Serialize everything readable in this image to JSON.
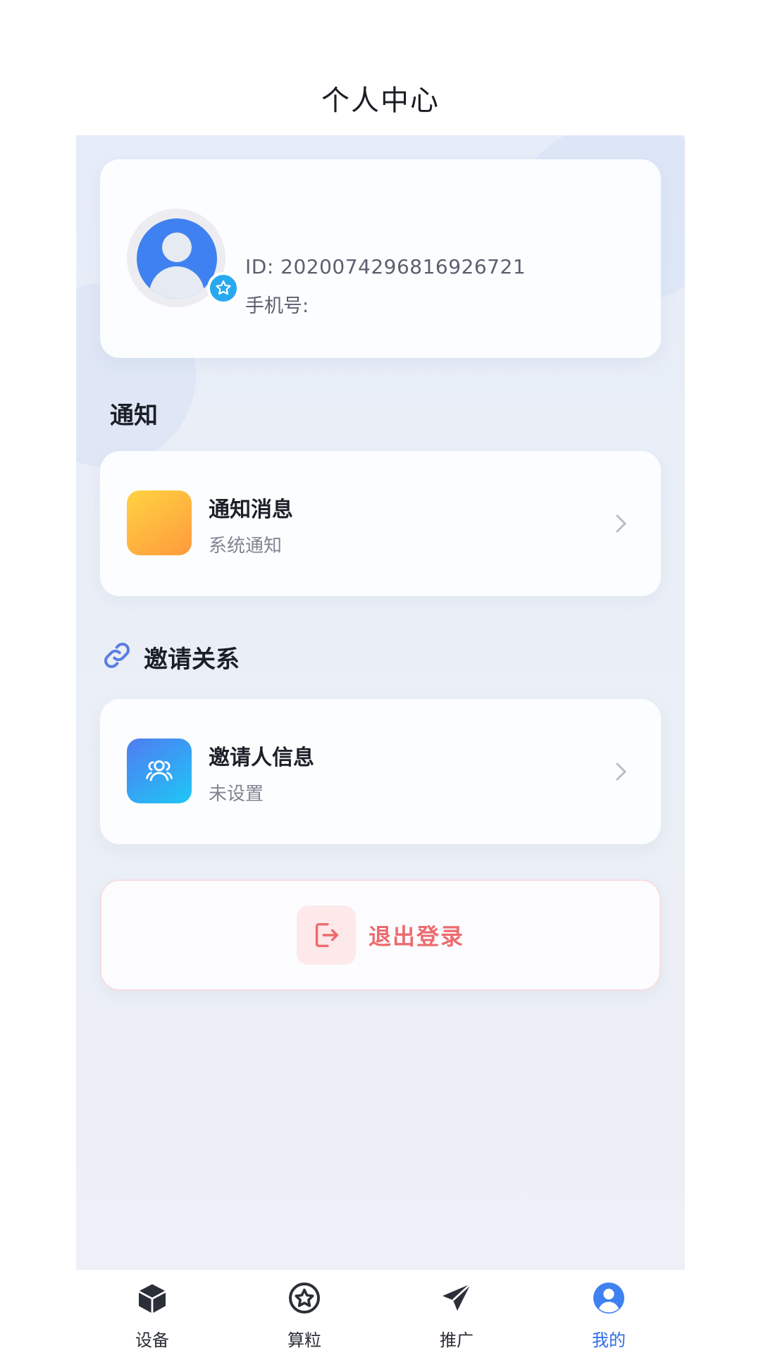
{
  "page": {
    "title": "个人中心"
  },
  "profile": {
    "id_text": "ID: 2020074296816926721",
    "phone_label": "手机号:"
  },
  "notifications": {
    "section_title": "通知",
    "item": {
      "title": "通知消息",
      "subtitle": "系统通知"
    }
  },
  "invite": {
    "section_title": "邀请关系",
    "item": {
      "title": "邀请人信息",
      "subtitle": "未设置"
    }
  },
  "logout": {
    "label": "退出登录"
  },
  "tabbar": {
    "items": [
      {
        "label": "设备",
        "icon": "cube-icon"
      },
      {
        "label": "算粒",
        "icon": "star-circle-icon"
      },
      {
        "label": "推广",
        "icon": "paper-plane-icon"
      },
      {
        "label": "我的",
        "icon": "user-icon",
        "active": true
      }
    ]
  },
  "colors": {
    "accent": "#2f6ee6",
    "logout_red": "#ee6b6f",
    "avatar_blue": "#3f81f0"
  }
}
